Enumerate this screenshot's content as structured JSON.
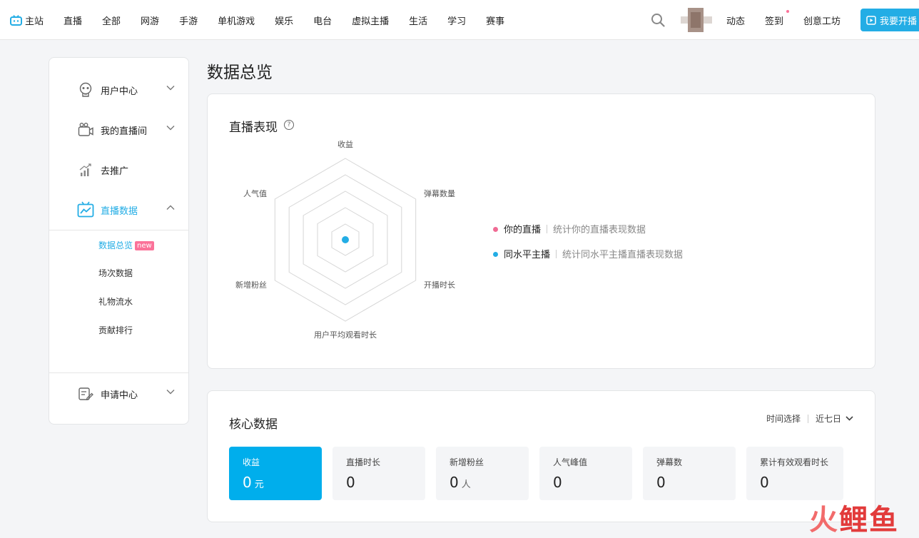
{
  "topnav": {
    "home": "主站",
    "items": [
      "直播",
      "全部",
      "网游",
      "手游",
      "单机游戏",
      "娱乐",
      "电台",
      "虚拟主播",
      "生活",
      "学习",
      "赛事"
    ],
    "right_items": [
      "动态",
      "签到",
      "创意工坊"
    ],
    "start_button": "我要开播"
  },
  "sidebar": {
    "groups": [
      {
        "label": "用户中心"
      },
      {
        "label": "我的直播间"
      },
      {
        "label": "去推广"
      },
      {
        "label": "直播数据"
      },
      {
        "label": "申请中心"
      }
    ],
    "sub_items": [
      "数据总览",
      "场次数据",
      "礼物流水",
      "贡献排行"
    ],
    "new_badge": "new"
  },
  "page": {
    "title": "数据总览"
  },
  "live_card": {
    "title": "直播表现",
    "help_glyph": "?",
    "radar_axes": [
      "收益",
      "弹幕数量",
      "开播时长",
      "用户平均观看时长",
      "新增粉丝",
      "人气值"
    ],
    "legend": [
      {
        "name": "你的直播",
        "desc": "统计你的直播表现数据",
        "color": "#f06b94"
      },
      {
        "name": "同水平主播",
        "desc": "统计同水平主播直播表现数据",
        "color": "#23ade5"
      }
    ]
  },
  "core_card": {
    "title": "核心数据",
    "time_label": "时间选择",
    "time_value": "近七日",
    "metrics": [
      {
        "label": "收益",
        "value": "0",
        "unit": "元"
      },
      {
        "label": "直播时长",
        "value": "0",
        "unit": ""
      },
      {
        "label": "新增粉丝",
        "value": "0",
        "unit": "人"
      },
      {
        "label": "人气峰值",
        "value": "0",
        "unit": ""
      },
      {
        "label": "弹幕数",
        "value": "0",
        "unit": ""
      },
      {
        "label": "累计有效观看时长",
        "value": "0",
        "unit": ""
      }
    ]
  },
  "watermark": {
    "part1": "火",
    "part2": "鲤鱼"
  },
  "colors": {
    "accent": "#23ade5",
    "active_metric": "#00aeec",
    "pink": "#fb7299"
  }
}
